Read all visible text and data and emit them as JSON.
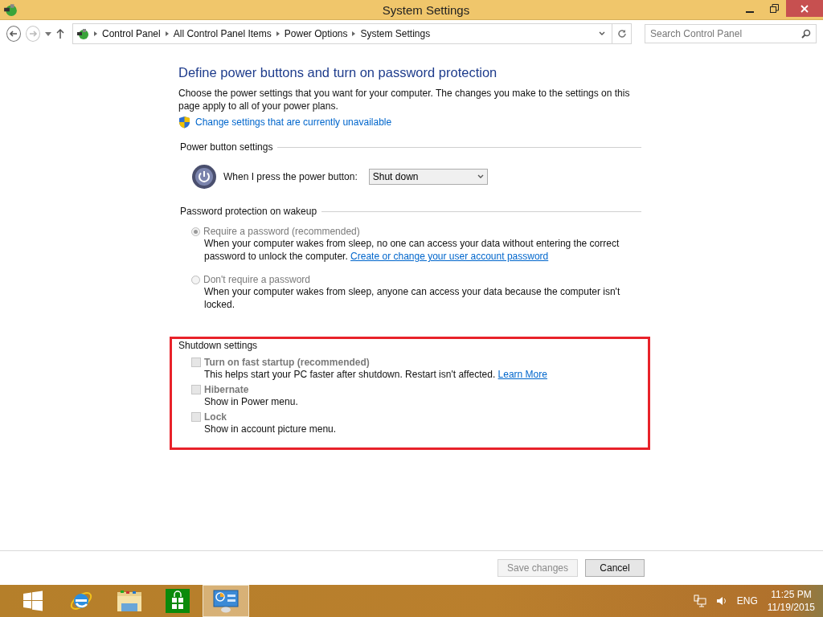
{
  "window": {
    "title": "System Settings"
  },
  "address_bar": {
    "breadcrumbs": [
      "Control Panel",
      "All Control Panel Items",
      "Power Options",
      "System Settings"
    ]
  },
  "search": {
    "placeholder": "Search Control Panel"
  },
  "page": {
    "heading": "Define power buttons and turn on password protection",
    "intro": "Choose the power settings that you want for your computer. The changes you make to the settings on this page apply to all of your power plans.",
    "admin_link": "Change settings that are currently unavailable"
  },
  "power_button": {
    "section": "Power button settings",
    "label": "When I press the power button:",
    "value": "Shut down"
  },
  "password": {
    "section": "Password protection on wakeup",
    "options": [
      {
        "label": "Require a password (recommended)",
        "description": "When your computer wakes from sleep, no one can access your data without entering the correct password to unlock the computer.",
        "link": "Create or change your user account password",
        "selected": true,
        "disabled": true
      },
      {
        "label": "Don't require a password",
        "description": "When your computer wakes from sleep, anyone can access your data because the computer isn't locked.",
        "selected": false,
        "disabled": true
      }
    ]
  },
  "shutdown": {
    "section": "Shutdown settings",
    "highlighted": true,
    "options": [
      {
        "label": "Turn on fast startup (recommended)",
        "description": "This helps start your PC faster after shutdown. Restart isn't affected.",
        "link": "Learn More",
        "checked": false,
        "disabled": true
      },
      {
        "label": "Hibernate",
        "description": "Show in Power menu.",
        "checked": false,
        "disabled": true
      },
      {
        "label": "Lock",
        "description": "Show in account picture menu.",
        "checked": false,
        "disabled": true
      }
    ]
  },
  "buttons": [
    {
      "label": "Save changes",
      "disabled": true
    },
    {
      "label": "Cancel",
      "disabled": false
    }
  ],
  "taskbar": {
    "apps": [
      {
        "kind": "start",
        "selected": false
      },
      {
        "kind": "browser",
        "selected": false
      },
      {
        "kind": "explorer",
        "selected": false
      },
      {
        "kind": "store",
        "selected": false
      },
      {
        "kind": "control_panel",
        "selected": true
      }
    ]
  },
  "tray": {
    "language": "ENG",
    "time": "11:25 PM",
    "date": "11/19/2015"
  }
}
